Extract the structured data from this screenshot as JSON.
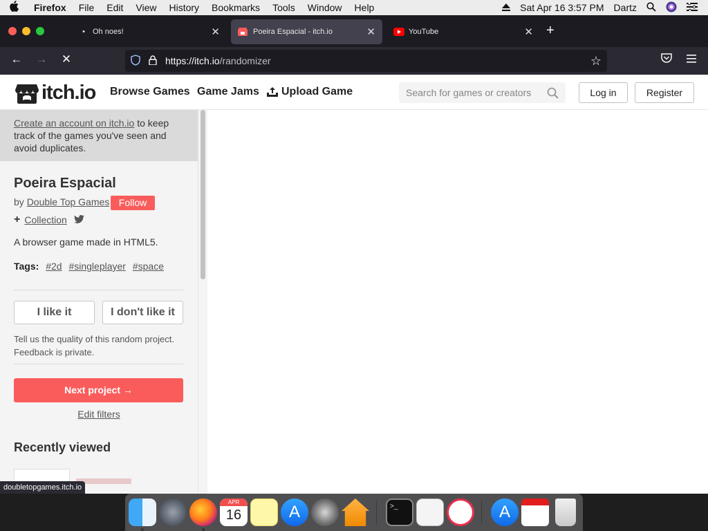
{
  "menubar": {
    "apple": "",
    "app": "Firefox",
    "items": [
      "File",
      "Edit",
      "View",
      "History",
      "Bookmarks",
      "Tools",
      "Window",
      "Help"
    ],
    "datetime": "Sat Apr 16  3:57 PM",
    "user": "Dartz"
  },
  "browser": {
    "tabs": [
      {
        "title": "Oh noes!"
      },
      {
        "title": "Poeira Espacial - itch.io"
      },
      {
        "title": "YouTube"
      }
    ],
    "new_tab": "+",
    "url_prefix": "https://itch.io",
    "url_path": "/randomizer"
  },
  "itch": {
    "logo_text": "itch.io",
    "nav": [
      "Browse Games",
      "Game Jams",
      "Upload Game"
    ],
    "search_placeholder": "Search for games or creators",
    "login": "Log in",
    "register": "Register"
  },
  "sidebar": {
    "notice_link": "Create an account on itch.io",
    "notice_rest": " to keep track of the games you've seen and avoid duplicates.",
    "game_title": "Poeira Espacial",
    "by_label": "by",
    "author": "Double Top Games",
    "follow": "Follow",
    "collection": "Collection",
    "description": "A browser game made in HTML5.",
    "tags_label": "Tags:",
    "tags": [
      "#2d",
      "#singleplayer",
      "#space"
    ],
    "like": "I like it",
    "dislike": "I don't like it",
    "feedback_help": "Tell us the quality of this random project. Feedback is private.",
    "next_project": "Next project →",
    "edit_filters": "Edit filters",
    "recently_viewed": "Recently viewed"
  },
  "status_url": "doubletopgames.itch.io",
  "dock": {
    "calendar_month": "APR",
    "calendar_day": "16"
  },
  "colors": {
    "itch_red": "#fa5c5c",
    "firefox_tabbar": "#1c1b22",
    "firefox_navbar": "#2b2a33"
  }
}
